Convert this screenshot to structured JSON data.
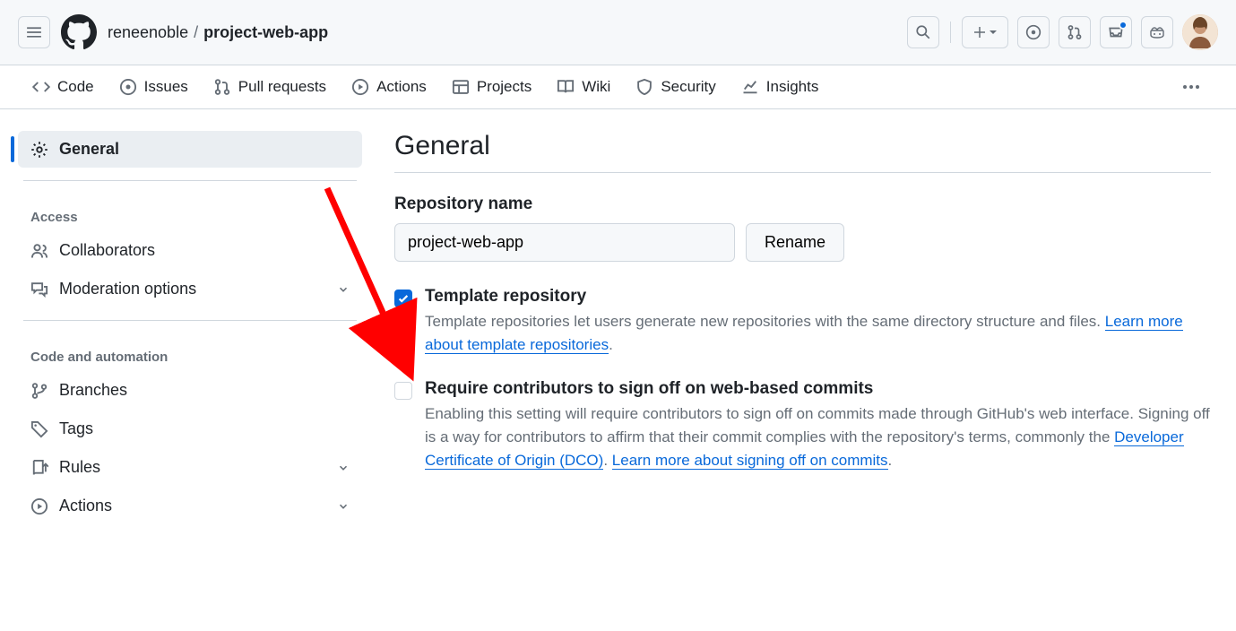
{
  "header": {
    "owner": "reneenoble",
    "separator": "/",
    "repo": "project-web-app"
  },
  "nav": {
    "code": "Code",
    "issues": "Issues",
    "pulls": "Pull requests",
    "actions": "Actions",
    "projects": "Projects",
    "wiki": "Wiki",
    "security": "Security",
    "insights": "Insights"
  },
  "sidebar": {
    "general": "General",
    "access_header": "Access",
    "collaborators": "Collaborators",
    "moderation": "Moderation options",
    "code_header": "Code and automation",
    "branches": "Branches",
    "tags": "Tags",
    "rules": "Rules",
    "actions": "Actions"
  },
  "content": {
    "heading": "General",
    "repo_name_label": "Repository name",
    "repo_name_value": "project-web-app",
    "rename_label": "Rename",
    "template": {
      "title": "Template repository",
      "desc": "Template repositories let users generate new repositories with the same directory structure and files. ",
      "link": "Learn more about template repositories",
      "checked": true
    },
    "signoff": {
      "title": "Require contributors to sign off on web-based commits",
      "desc_a": "Enabling this setting will require contributors to sign off on commits made through GitHub's web interface. Signing off is a way for contributors to affirm that their commit complies with the repository's terms, commonly the ",
      "link1": "Developer Certificate of Origin (DCO)",
      "mid": ". ",
      "link2": "Learn more about signing off on commits",
      "end": ".",
      "checked": false
    }
  }
}
